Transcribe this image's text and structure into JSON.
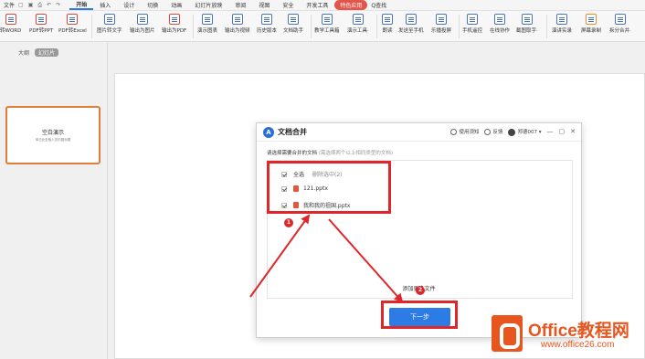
{
  "menubar": {
    "file": "文件",
    "items": [
      "开始",
      "插入",
      "设计",
      "切换",
      "动画",
      "幻灯片放映",
      "审阅",
      "视图",
      "安全",
      "开发工具"
    ],
    "special": "特色应用",
    "search": "Q查找"
  },
  "ribbon": {
    "buttons": [
      "转WORD",
      "PDF转PPT",
      "PDF转Excel",
      "图片转文字",
      "输出为图片",
      "输出为PDF",
      "演示图表",
      "输出为视频",
      "历史版本",
      "文档助手",
      "教学工具箱",
      "演示工具·",
      "朗读",
      "发送至手机",
      "乐播投屏",
      "手机遥控",
      "在线协作",
      "截图取字·",
      "演讲实录",
      "屏幕录制",
      "拆分合并·"
    ]
  },
  "leftpane": {
    "tab_outline": "大纲",
    "tab_slides": "幻灯片",
    "thumb_title": "空白演示",
    "thumb_subtitle": "单击此处输入您的副标题"
  },
  "dialog": {
    "logo": "A",
    "title": "文档合并",
    "help": "使用须知",
    "feedback": "反馈",
    "user": "郑德007",
    "instruction": "请选择需要合并的文档",
    "instruction_sub": "(需选择两个以上相同类型的文档)",
    "select_all": "全选",
    "delete_selected": "删除选中(2)",
    "files": [
      "121.pptx",
      "我和我的祖国.pptx"
    ],
    "add_more": "添加更多文件",
    "next": "下一步"
  },
  "badges": [
    "1",
    "2"
  ],
  "watermark": {
    "brand": "Office教程网",
    "url": "www.office26.com"
  },
  "colors": {
    "accent": "#2d7be5",
    "annotation_red": "#e0262a",
    "special_tab": "#e3544a",
    "watermark": "#e7561f"
  }
}
